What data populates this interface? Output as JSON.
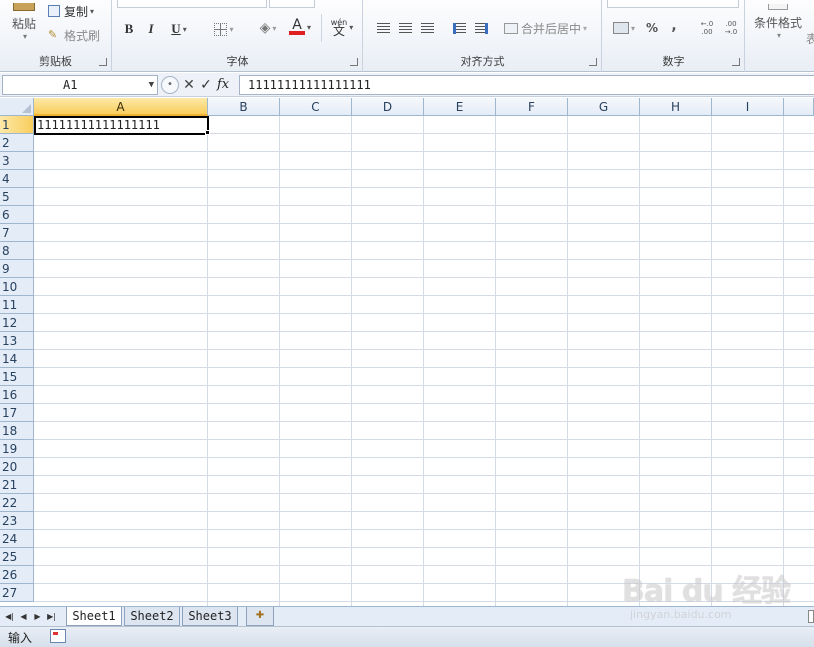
{
  "ribbon": {
    "clipboard": {
      "paste_label": "粘贴",
      "copy_label": "复制",
      "format_painter_label": "格式刷",
      "group_label": "剪贴板"
    },
    "font": {
      "bold": "B",
      "italic": "I",
      "underline": "U",
      "font_color_glyph": "A",
      "phonetic_glyph": "wén",
      "group_label": "字体"
    },
    "alignment": {
      "merge_label": "合并后居中",
      "group_label": "对齐方式"
    },
    "number": {
      "percent": "%",
      "comma": ",",
      "inc_decimal": "←.0 .00",
      "dec_decimal": ".00 →.0",
      "group_label": "数字"
    },
    "styles": {
      "conditional_format_label": "条件格式",
      "table_label": "表"
    },
    "colors": {
      "font_color_bar": "#e02020",
      "accent": "#f8cd5c"
    }
  },
  "formula_bar": {
    "name_box": "A1",
    "cancel_glyph": "✕",
    "enter_glyph": "✓",
    "fx_label": "fx",
    "content": "11111111111111111"
  },
  "grid": {
    "columns": [
      "A",
      "B",
      "C",
      "D",
      "E",
      "F",
      "G",
      "H",
      "I"
    ],
    "rows": [
      "1",
      "2",
      "3",
      "4",
      "5",
      "6",
      "7",
      "8",
      "9",
      "10",
      "11",
      "12",
      "13",
      "14",
      "15",
      "16",
      "17",
      "18",
      "19",
      "20",
      "21",
      "22",
      "23",
      "24",
      "25",
      "26",
      "27"
    ],
    "selected_cell": "A1",
    "cell_a1_value": "11111111111111111"
  },
  "sheets": {
    "tabs": [
      "Sheet1",
      "Sheet2",
      "Sheet3"
    ],
    "active": "Sheet1"
  },
  "status_bar": {
    "mode": "输入"
  },
  "watermark": {
    "logo": "Bai du 经验",
    "url": "jingyan.baidu.com"
  }
}
